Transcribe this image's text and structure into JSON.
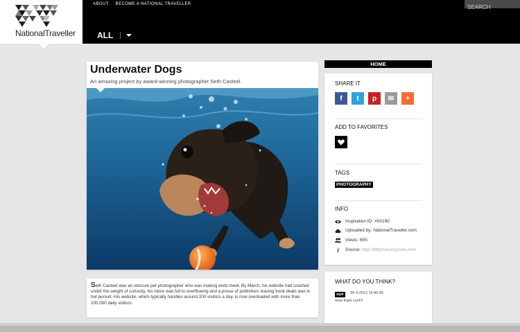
{
  "brand": {
    "name": "NationalTraveller"
  },
  "topnav": [
    {
      "label": "ABOUT"
    },
    {
      "label": "BECOME A NATIONAL TRAVELLER"
    }
  ],
  "search": {
    "placeholder": "SEARCH"
  },
  "filter": {
    "label": "ALL"
  },
  "article": {
    "title": "Underwater Dogs",
    "subtitle": "An amazing project by award-winning photographer Seth Casteel.",
    "body_initial": "S",
    "body": "eth Casteel was an obscure pet photographer who was making ends meet. By March, his website had crashed under the weight of curiosity, his inbox was full to overflowing and a posse of publishers waving book deals was in hot pursuit. His website, which typically handles around 200 visitors a day, is now overloaded with more than 100,000 daily visitors."
  },
  "sidebar": {
    "home_label": "HOME",
    "share_heading": "SHARE IT",
    "share_buttons": [
      {
        "icon": "facebook-icon",
        "glyph": "f",
        "color": "#3b5998"
      },
      {
        "icon": "twitter-icon",
        "glyph": "t",
        "color": "#2fa4dc"
      },
      {
        "icon": "pinterest-icon",
        "glyph": "p",
        "color": "#cb2027"
      },
      {
        "icon": "email-icon",
        "glyph": "✉",
        "color": "#9a9a9a"
      },
      {
        "icon": "plus-icon",
        "glyph": "+",
        "color": "#f26c3a"
      }
    ],
    "favorites_heading": "ADD TO FAVORITES",
    "tags_heading": "TAGS",
    "tag": "PHOTOGRAPHY",
    "info_heading": "INFO",
    "info": {
      "id_key": "Inspiration ID:",
      "id_value": "#00190",
      "uploaded_key": "Uploaded by:",
      "uploaded_value": "NationalTraveller.com",
      "views_key": "Views:",
      "views_value": "655",
      "source_key": "Source:",
      "source_value": "http://littlefriendsphoto.com"
    }
  },
  "comments": {
    "heading": "WHAT DO YOU THINK?",
    "author": "sqot",
    "timestamp": "30-4-2012 16:45:45",
    "text": "wow thats cool!!!"
  }
}
